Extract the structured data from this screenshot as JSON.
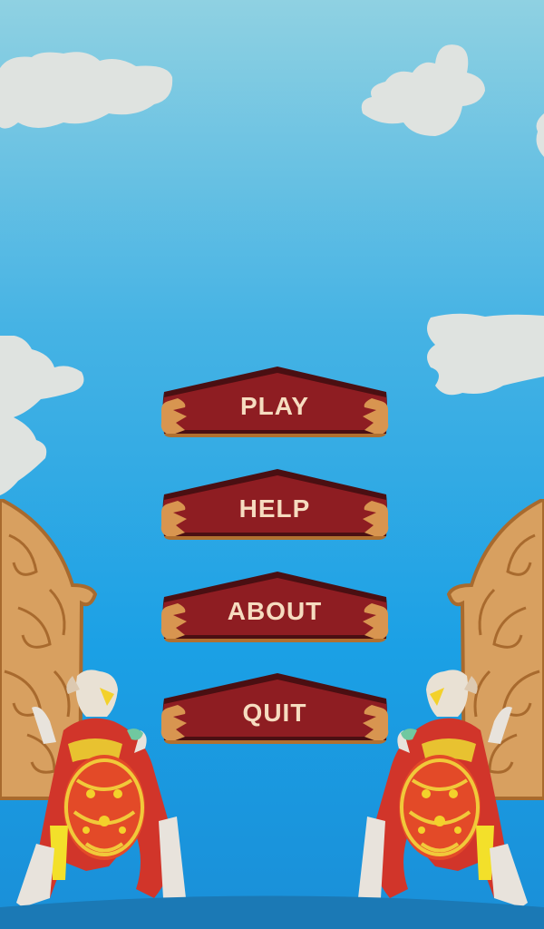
{
  "menu": {
    "play_label": "PLAY",
    "help_label": "HELP",
    "about_label": "ABOUT",
    "quit_label": "QUIT"
  },
  "colors": {
    "sky_top": "#8fd1e2",
    "sky_bottom": "#1a8fd8",
    "button_fill": "#8e1d22",
    "button_trim": "#d89550",
    "button_text": "#f6dcc0",
    "cloud": "#dfe3e0"
  },
  "icons": {
    "left_art": "balinese-dancer-and-carved-gate",
    "right_art": "balinese-dancer-and-carved-gate-mirrored"
  }
}
